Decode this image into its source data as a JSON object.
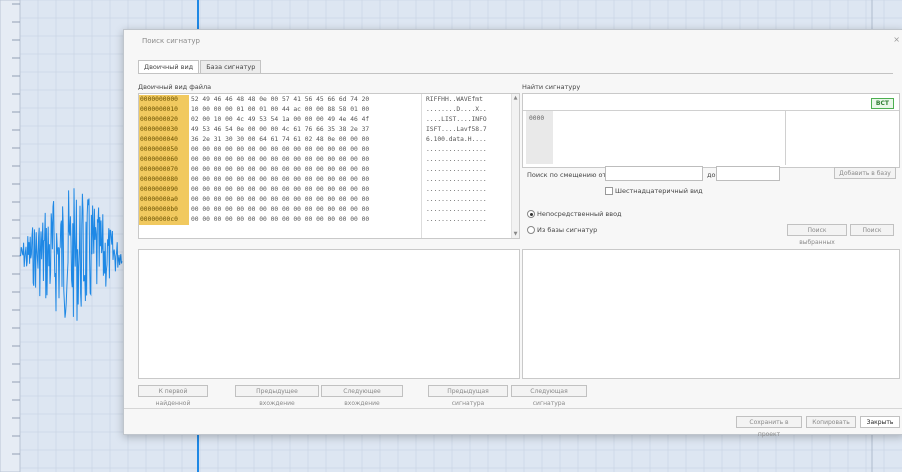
{
  "dialog": {
    "title": "Поиск сигнатур",
    "close": "×"
  },
  "tabs": [
    {
      "label": "Двоичный вид",
      "active": true
    },
    {
      "label": "База сигнатур",
      "active": false
    }
  ],
  "hex": {
    "label": "Двоичный вид файла",
    "rows": [
      {
        "offset": "0000000000",
        "bytes": "52 49 46 46 48 48 0e 00 57 41 56 45 66 6d 74 20",
        "ascii": "RIFFHH..WAVEfmt "
      },
      {
        "offset": "0000000010",
        "bytes": "10 00 00 00 01 00 01 00 44 ac 00 00 88 58 01 00",
        "ascii": "........D....X.."
      },
      {
        "offset": "0000000020",
        "bytes": "02 00 10 00 4c 49 53 54 1a 00 00 00 49 4e 46 4f",
        "ascii": "....LIST....INFO"
      },
      {
        "offset": "0000000030",
        "bytes": "49 53 46 54 0e 00 00 00 4c 61 76 66 35 38 2e 37",
        "ascii": "ISFT....Lavf58.7"
      },
      {
        "offset": "0000000040",
        "bytes": "36 2e 31 30 30 00 64 61 74 61 02 48 0e 00 00 00",
        "ascii": "6.100.data.H...."
      },
      {
        "offset": "0000000050",
        "bytes": "00 00 00 00 00 00 00 00 00 00 00 00 00 00 00 00",
        "ascii": "................"
      },
      {
        "offset": "0000000060",
        "bytes": "00 00 00 00 00 00 00 00 00 00 00 00 00 00 00 00",
        "ascii": "................"
      },
      {
        "offset": "0000000070",
        "bytes": "00 00 00 00 00 00 00 00 00 00 00 00 00 00 00 00",
        "ascii": "................"
      },
      {
        "offset": "0000000080",
        "bytes": "00 00 00 00 00 00 00 00 00 00 00 00 00 00 00 00",
        "ascii": "................"
      },
      {
        "offset": "0000000090",
        "bytes": "00 00 00 00 00 00 00 00 00 00 00 00 00 00 00 00",
        "ascii": "................"
      },
      {
        "offset": "00000000a0",
        "bytes": "00 00 00 00 00 00 00 00 00 00 00 00 00 00 00 00",
        "ascii": "................"
      },
      {
        "offset": "00000000b0",
        "bytes": "00 00 00 00 00 00 00 00 00 00 00 00 00 00 00 00",
        "ascii": "................"
      },
      {
        "offset": "00000000c0",
        "bytes": "00 00 00 00 00 00 00 00 00 00 00 00 00 00 00 00",
        "ascii": "................"
      },
      {
        "offset": "",
        "bytes": "",
        "ascii": ""
      }
    ]
  },
  "find": {
    "label": "Найти сигнатуру",
    "badge": "BCT",
    "offset_text": "0000",
    "search_from_label": "Поиск по смещению от:",
    "to_label": "до:",
    "add_to_base": "Добавить в базу",
    "hex_checkbox": "Шестнадцатеричный вид",
    "radio_direct": "Непосредственный ввод",
    "radio_base": "Из базы сигнатур",
    "search_selected": "Поиск выбранных",
    "search": "Поиск"
  },
  "bottom": {
    "first_found": "К первой найденной",
    "prev_occurrence": "Предыдущее вхождение",
    "next_occurrence": "Следующее вхождение",
    "prev_signature": "Предыдущая сигнатура",
    "next_signature": "Следующая сигнатура"
  },
  "footer": {
    "save_to_project": "Сохранить в проект",
    "copy": "Копировать",
    "close": "Закрыть"
  },
  "colors": {
    "waveform": "#1e88e5",
    "offset_highlight": "#f1c95f",
    "badge_green": "#4caf50"
  }
}
